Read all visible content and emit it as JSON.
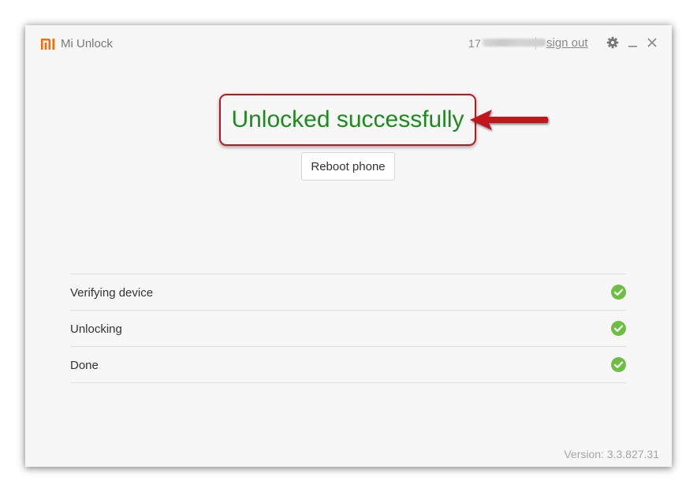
{
  "header": {
    "app_title": "Mi Unlock",
    "account_id": "17",
    "sign_out_label": "sign out",
    "settings_icon": "gear-icon",
    "minimize_icon": "minimize-icon",
    "close_icon": "close-icon"
  },
  "main": {
    "status_text": "Unlocked successfully",
    "reboot_label": "Reboot phone",
    "steps": [
      {
        "label": "Verifying device",
        "status": "done",
        "icon": "check-circle-icon"
      },
      {
        "label": "Unlocking",
        "status": "done",
        "icon": "check-circle-icon"
      },
      {
        "label": "Done",
        "status": "done",
        "icon": "check-circle-icon"
      }
    ]
  },
  "footer": {
    "version": "Version: 3.3.827.31"
  },
  "colors": {
    "brand": "#ff6700",
    "success": "#1e8a1e",
    "check": "#6dbe45",
    "highlight": "#c0161b"
  }
}
